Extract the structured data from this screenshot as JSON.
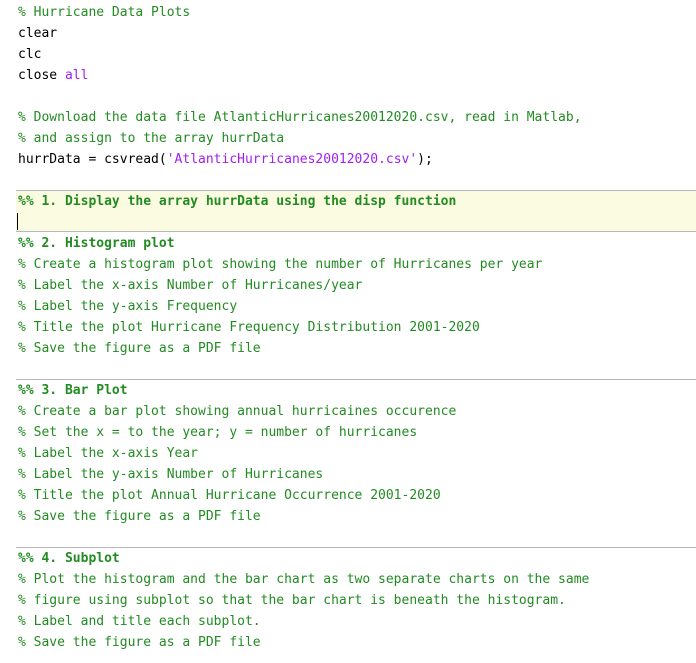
{
  "editor": {
    "lines": {
      "l01": "% Hurricane Data Plots",
      "l02": "clear",
      "l03": "clc",
      "l04a": "close ",
      "l04b": "all",
      "l06": "% Download the data file AtlanticHurricanes20012020.csv, read in Matlab,",
      "l07": "% and assign to the array hurrData",
      "l08a": "hurrData = csvread(",
      "l08b": "'AtlanticHurricanes20012020.csv'",
      "l08c": ");",
      "l10": "%% 1. Display the array hurrData using the disp function",
      "l12": "%% 2. Histogram plot",
      "l13": "% Create a histogram plot showing the number of Hurricanes per year",
      "l14": "% Label the x-axis Number of Hurricanes/year",
      "l15": "% Label the y-axis Frequency",
      "l16": "% Title the plot Hurricane Frequency Distribution 2001-2020",
      "l17": "% Save the figure as a PDF file",
      "l19": "%% 3. Bar Plot",
      "l20": "% Create a bar plot showing annual hurricaines occurence",
      "l21": "% Set the x = to the year; y = number of hurricanes",
      "l22": "% Label the x-axis Year",
      "l23": "% Label the y-axis Number of Hurricanes",
      "l24": "% Title the plot Annual Hurricane Occurrence 2001-2020",
      "l25": "% Save the figure as a PDF file",
      "l27": "%% 4. Subplot",
      "l28": "% Plot the histogram and the bar chart as two separate charts on the same",
      "l29": "% figure using subplot so that the bar chart is beneath the histogram.",
      "l30": "% Label and title each subplot.",
      "l31": "% Save the figure as a PDF file"
    },
    "colors": {
      "comment": "#228b22",
      "string": "#a020f0",
      "active_cell_bg": "#fbfbe2"
    }
  }
}
